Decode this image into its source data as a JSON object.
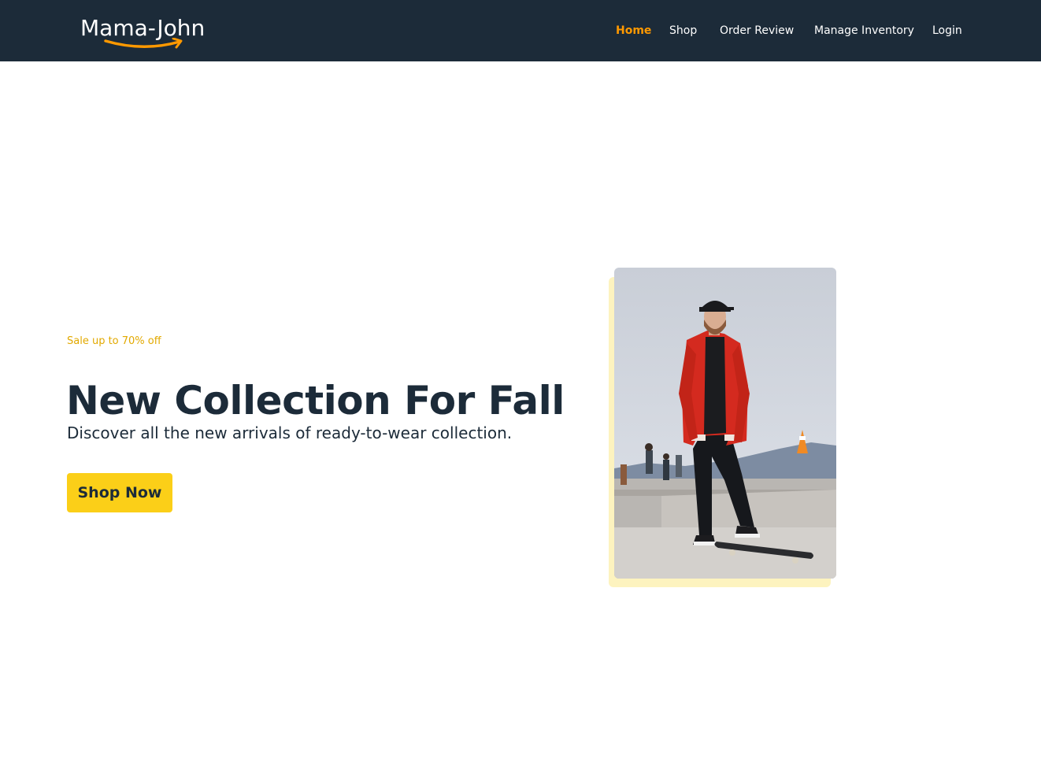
{
  "brand": {
    "name": "Mama-John"
  },
  "nav": {
    "items": [
      {
        "label": "Home",
        "active": true
      },
      {
        "label": "Shop",
        "active": false
      },
      {
        "label": "Order Review",
        "active": false
      },
      {
        "label": "Manage Inventory",
        "active": false
      },
      {
        "label": "Login",
        "active": false
      }
    ]
  },
  "hero": {
    "sale": "Sale up to 70% off",
    "title": "New Collection For Fall",
    "subtitle": "Discover all the new arrivals of ready-to-wear collection.",
    "cta": "Shop Now"
  },
  "colors": {
    "navbar": "#1c2b39",
    "accent": "#ff9900",
    "button": "#fbcf18",
    "sale": "#e2a900",
    "photo_backdrop": "#fdf3bf"
  }
}
